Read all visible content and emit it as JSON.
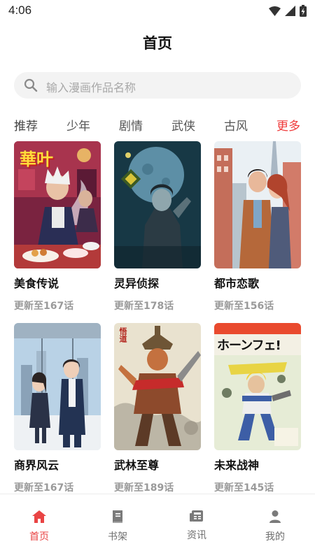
{
  "status_bar": {
    "time": "4:06"
  },
  "header": {
    "title": "首页"
  },
  "search": {
    "placeholder": "输入漫画作品名称"
  },
  "tabs": [
    {
      "label": "推荐"
    },
    {
      "label": "少年"
    },
    {
      "label": "剧情"
    },
    {
      "label": "武侠"
    },
    {
      "label": "古风"
    },
    {
      "label": "更多"
    }
  ],
  "comics": [
    {
      "title": "美食传说",
      "update": "更新至167话",
      "cover_text": "華叶"
    },
    {
      "title": "灵异侦探",
      "update": "更新至178话"
    },
    {
      "title": "都市恋歌",
      "update": "更新至156话"
    },
    {
      "title": "商界风云",
      "update": "更新至167话"
    },
    {
      "title": "武林至尊",
      "update": "更新至189话",
      "cover_text": "悟道"
    },
    {
      "title": "未来战神",
      "update": "更新至145话",
      "cover_text": "ホーンフェ!"
    }
  ],
  "bottom_nav": [
    {
      "label": "首页",
      "icon": "home-icon"
    },
    {
      "label": "书架",
      "icon": "book-icon"
    },
    {
      "label": "资讯",
      "icon": "news-icon"
    },
    {
      "label": "我的",
      "icon": "user-icon"
    }
  ],
  "colors": {
    "accent": "#e94444",
    "more_tab": "#ef3b3b",
    "text_gray": "#9a9a9a"
  }
}
